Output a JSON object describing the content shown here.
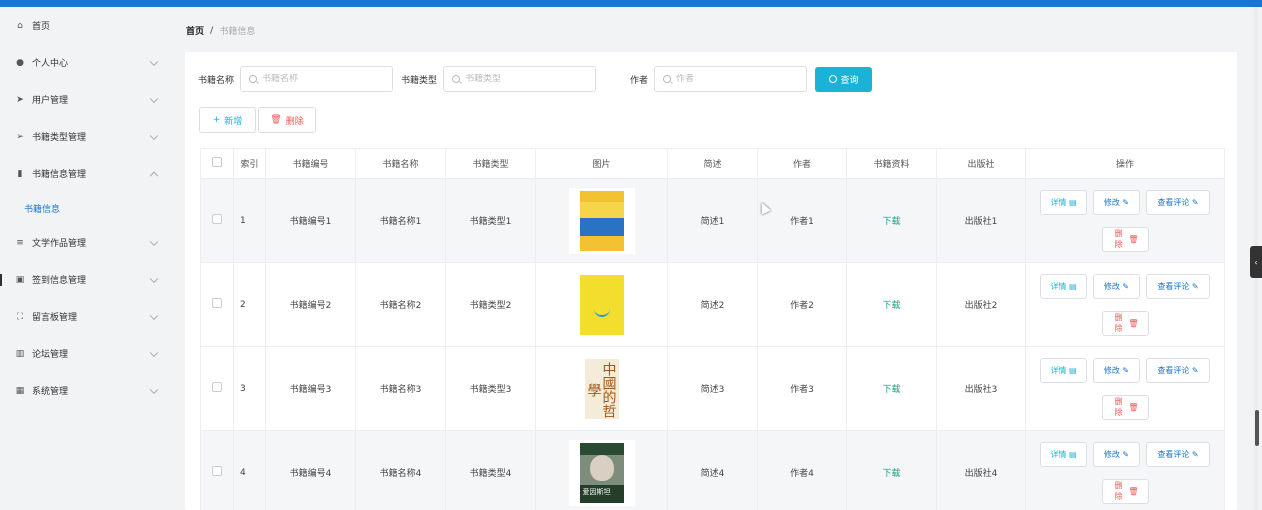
{
  "sidebar": {
    "items": [
      {
        "label": "首页",
        "icon": "home-icon",
        "glyph": "⌂",
        "expandable": false
      },
      {
        "label": "个人中心",
        "icon": "user-icon",
        "glyph": "●",
        "expandable": true
      },
      {
        "label": "用户管理",
        "icon": "send-icon",
        "glyph": "➤",
        "expandable": true
      },
      {
        "label": "书籍类型管理",
        "icon": "navigation-icon",
        "glyph": "➢",
        "expandable": true
      },
      {
        "label": "书籍信息管理",
        "icon": "bar-chart-icon",
        "glyph": "▮",
        "expandable": true,
        "expanded": true
      },
      {
        "label": "文学作品管理",
        "icon": "menu-icon",
        "glyph": "≡",
        "expandable": true
      },
      {
        "label": "签到信息管理",
        "icon": "clipboard-icon",
        "glyph": "▣",
        "expandable": true
      },
      {
        "label": "留言板管理",
        "icon": "frame-icon",
        "glyph": "⛶",
        "expandable": true
      },
      {
        "label": "论坛管理",
        "icon": "columns-icon",
        "glyph": "▥",
        "expandable": true
      },
      {
        "label": "系统管理",
        "icon": "grid-icon",
        "glyph": "▦",
        "expandable": true
      }
    ],
    "submenu": {
      "label": "书籍信息"
    }
  },
  "breadcrumb": {
    "home": "首页",
    "separator": "/",
    "current": "书籍信息"
  },
  "search": {
    "name_label": "书籍名称",
    "name_placeholder": "书籍名称",
    "type_label": "书籍类型",
    "type_placeholder": "书籍类型",
    "author_label": "作者",
    "author_placeholder": "作者",
    "query_label": "查询"
  },
  "actions": {
    "add_label": "新增",
    "delete_label": "删除"
  },
  "table": {
    "headers": [
      "",
      "索引",
      "书籍编号",
      "书籍名称",
      "书籍类型",
      "图片",
      "简述",
      "作者",
      "书籍资料",
      "出版社",
      "操作"
    ],
    "rows": [
      {
        "index": "1",
        "code": "书籍编号1",
        "name": "书籍名称1",
        "type": "书籍类型1",
        "summary": "简述1",
        "author": "作者1",
        "material": "下载",
        "publisher": "出版社1"
      },
      {
        "index": "2",
        "code": "书籍编号2",
        "name": "书籍名称2",
        "type": "书籍类型2",
        "summary": "简述2",
        "author": "作者2",
        "material": "下载",
        "publisher": "出版社2"
      },
      {
        "index": "3",
        "code": "书籍编号3",
        "name": "书籍名称3",
        "type": "书籍类型3",
        "summary": "简述3",
        "author": "作者3",
        "material": "下载",
        "publisher": "出版社3"
      },
      {
        "index": "4",
        "code": "书籍编号4",
        "name": "书籍名称4",
        "type": "书籍类型4",
        "summary": "简述4",
        "author": "作者4",
        "material": "下载",
        "publisher": "出版社4"
      }
    ],
    "op_labels": {
      "detail": "详情",
      "edit": "修改",
      "review": "查看评论",
      "remove": "删除"
    }
  },
  "covers": {
    "book3_title": "中國的哲學",
    "book4_title": "爱因斯坦"
  },
  "colors": {
    "accent": "#1bb2d8",
    "topbar": "#1677d8",
    "danger": "#e55555",
    "link": "#16a085"
  }
}
